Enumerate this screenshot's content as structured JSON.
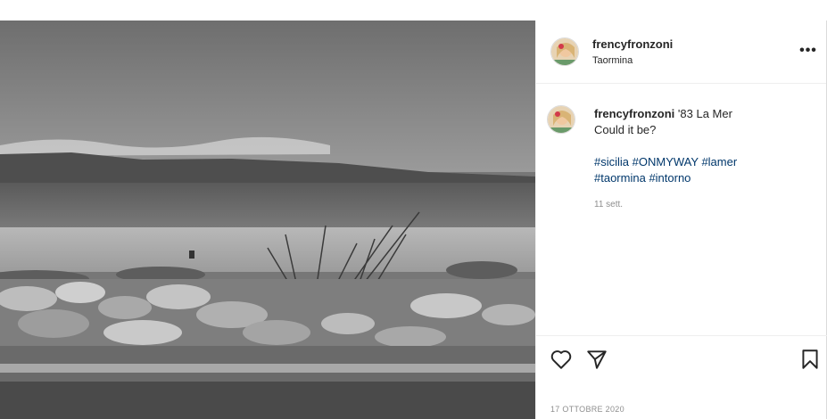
{
  "post": {
    "username": "frencyfronzoni",
    "location": "Taormina",
    "caption": {
      "username": "frencyfronzoni",
      "line1": "'83 La Mer",
      "line2": "Could it be?",
      "hashtags_line1": [
        "#sicilia",
        "#ONMYWAY",
        "#lamer"
      ],
      "hashtags_line2": [
        "#taormina",
        "#intorno"
      ],
      "time_ago": "11 sett."
    },
    "date": "17 OTTOBRE 2020"
  },
  "icons": {
    "more": "more-options-icon",
    "like": "heart-icon",
    "share": "paper-plane-icon",
    "save": "bookmark-icon"
  },
  "colors": {
    "hashtag": "#00376b",
    "muted": "#8e8e8e",
    "text": "#262626"
  }
}
